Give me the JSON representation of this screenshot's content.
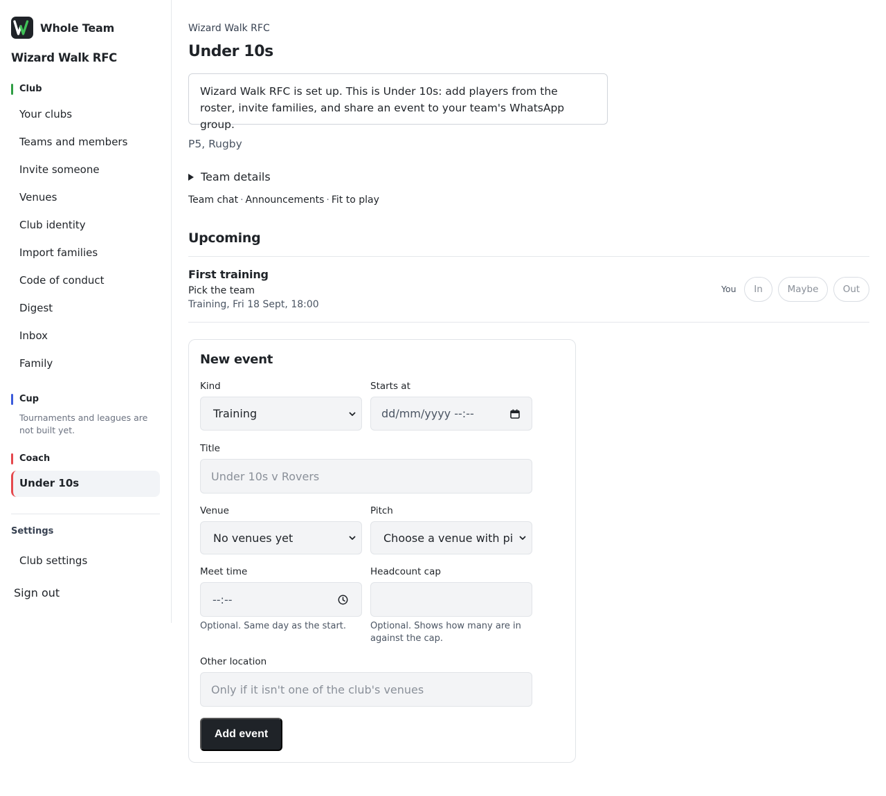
{
  "sidebar": {
    "brand_name": "Whole Team",
    "club_name": "Wizard Walk RFC",
    "sections": {
      "club": {
        "label": "Club",
        "bar_color": "#2f9e44",
        "items": [
          "Your clubs",
          "Teams and members",
          "Invite someone",
          "Venues",
          "Club identity",
          "Import families",
          "Code of conduct",
          "Digest",
          "Inbox",
          "Family"
        ]
      },
      "cup": {
        "label": "Cup",
        "bar_color": "#3b5bdb",
        "note": "Tournaments and leagues are not built yet."
      },
      "coach": {
        "label": "Coach",
        "bar_color": "#e5484d",
        "active_item": "Under 10s"
      }
    },
    "settings_label": "Settings",
    "club_settings": "Club settings",
    "sign_out": "Sign out"
  },
  "main": {
    "breadcrumb": "Wizard Walk RFC",
    "title": "Under 10s",
    "notice": "Wizard Walk RFC is set up. This is Under 10s: add players from the roster, invite families, and share an event to your team's WhatsApp group.",
    "meta": "P5, Rugby",
    "team_details": "Team details",
    "links": [
      "Team chat",
      "Announcements",
      "Fit to play"
    ],
    "upcoming_heading": "Upcoming",
    "event": {
      "title": "First training",
      "subtitle": "Pick the team",
      "when": "Training, Fri 18 Sept, 18:00",
      "you_label": "You",
      "rsvp": [
        "In",
        "Maybe",
        "Out"
      ]
    },
    "new_event": {
      "heading": "New event",
      "kind_label": "Kind",
      "kind_value": "Training",
      "starts_label": "Starts at",
      "starts_placeholder": "dd/mm/yyyy --:--",
      "title_label": "Title",
      "title_placeholder": "Under 10s v Rovers",
      "venue_label": "Venue",
      "venue_value": "No venues yet",
      "pitch_label": "Pitch",
      "pitch_value": "Choose a venue with pitc",
      "meet_label": "Meet time",
      "meet_placeholder": "--:--",
      "meet_hint": "Optional. Same day as the start.",
      "cap_label": "Headcount cap",
      "cap_hint": "Optional. Shows how many are in against the cap.",
      "other_label": "Other location",
      "other_placeholder": "Only if it isn't one of the club's venues",
      "submit": "Add event"
    }
  }
}
